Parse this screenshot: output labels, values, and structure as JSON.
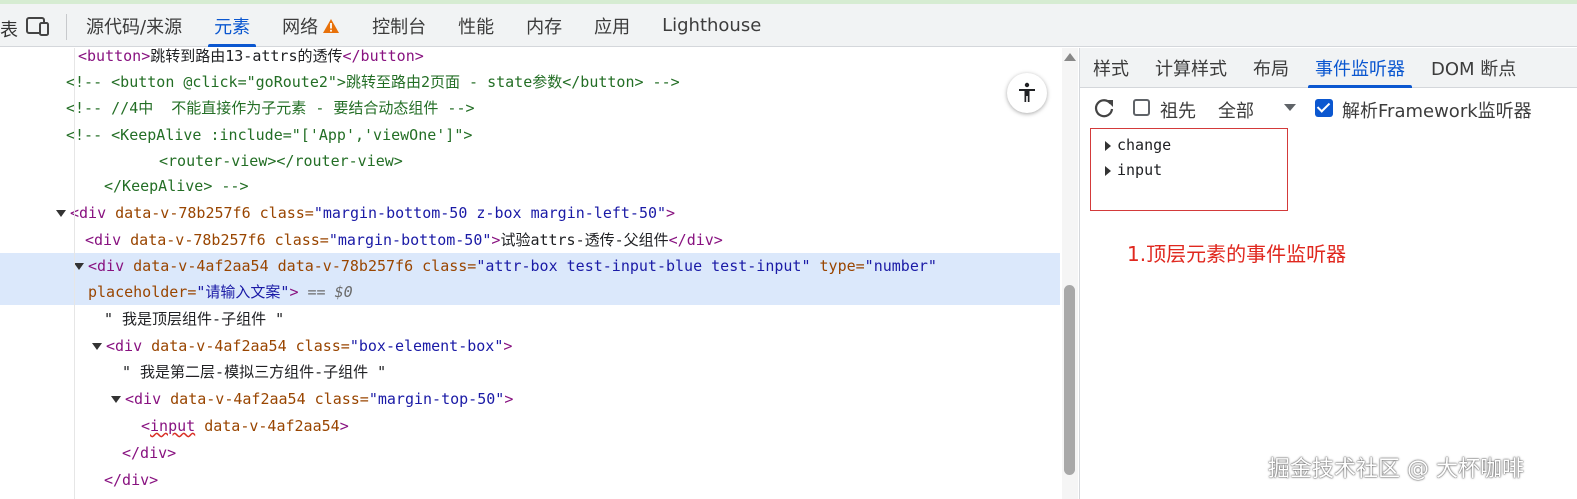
{
  "toolbar": {
    "partial_left": "表",
    "tabs": [
      {
        "label": "源代码/来源"
      },
      {
        "label": "元素"
      },
      {
        "label": "网络"
      },
      {
        "label": "控制台"
      },
      {
        "label": "性能"
      },
      {
        "label": "内存"
      },
      {
        "label": "应用"
      },
      {
        "label": "Lighthouse"
      }
    ],
    "active_tab": "元素"
  },
  "elements": {
    "lines": {
      "l0": {
        "open": "<button>",
        "text": "跳转到路由13-attrs的透传",
        "close": "</button>"
      },
      "l1": "<!-- <button @click=\"goRoute2\">跳转至路由2页面 - state参数</button> -->",
      "l2": "<!-- //4中  不能直接作为子元素 - 要结合动态组件 -->",
      "l3": "<!-- <KeepAlive :include=\"['App','viewOne']\">",
      "l4": "<router-view></router-view>",
      "l5": "</KeepAlive> -->",
      "l6": {
        "tag_open": "<div",
        "attr1": "data-v-78b257f6",
        "attr2": "class=",
        "val": "\"margin-bottom-50 z-box margin-left-50\"",
        "tag_close": ">"
      },
      "l7": {
        "tag_open": "<div",
        "attr1": "data-v-78b257f6",
        "attr2": "class=",
        "val": "\"margin-bottom-50\"",
        "gt": ">",
        "text": "试验attrs-透传-父组件",
        "close": "</div>"
      },
      "l8": {
        "tag_open": "<div",
        "attr1": "data-v-4af2aa54",
        "attr2": "data-v-78b257f6",
        "attr3": "class=",
        "val1": "\"attr-box test-input-blue test-input\"",
        "attr4": "type=",
        "val2": "\"number\""
      },
      "l9": {
        "attr": "placeholder=",
        "val": "\"请输入文案\"",
        "gt": ">",
        "dollar": "== $0"
      },
      "l10": "\" 我是顶层组件-子组件 \"",
      "l11": {
        "tag_open": "<div",
        "attr1": "data-v-4af2aa54",
        "attr2": "class=",
        "val": "\"box-element-box\"",
        "gt": ">"
      },
      "l12": "\" 我是第二层-模拟三方组件-子组件 \"",
      "l13": {
        "tag_open": "<div",
        "attr1": "data-v-4af2aa54",
        "attr2": "class=",
        "val": "\"margin-top-50\"",
        "gt": ">"
      },
      "l14": {
        "lt": "<",
        "tag": "input",
        "attr": "data-v-4af2aa54",
        "gt": ">"
      },
      "l15": "</div>",
      "l16": "</div>"
    }
  },
  "sidebar": {
    "tabs": [
      {
        "label": "样式"
      },
      {
        "label": "计算样式"
      },
      {
        "label": "布局"
      },
      {
        "label": "事件监听器"
      },
      {
        "label": "DOM 断点"
      }
    ],
    "active_tab": "事件监听器",
    "toolbar": {
      "ancestors_label": "祖先",
      "ancestors_checked": false,
      "filter_value": "全部",
      "framework_label": "解析Framework监听器",
      "framework_checked": true
    },
    "listeners": [
      {
        "name": "change"
      },
      {
        "name": "input"
      }
    ],
    "annotation": "1.顶层元素的事件监听器"
  },
  "watermark": "掘金技术社区 @ 大杯咖啡",
  "colors": {
    "accent": "#0b57d0",
    "annotation_red": "#e0281f",
    "tag": "#881280",
    "attr": "#994500",
    "value": "#1a1aa6",
    "comment": "#236e25",
    "highlight": "#dbe8fb"
  }
}
